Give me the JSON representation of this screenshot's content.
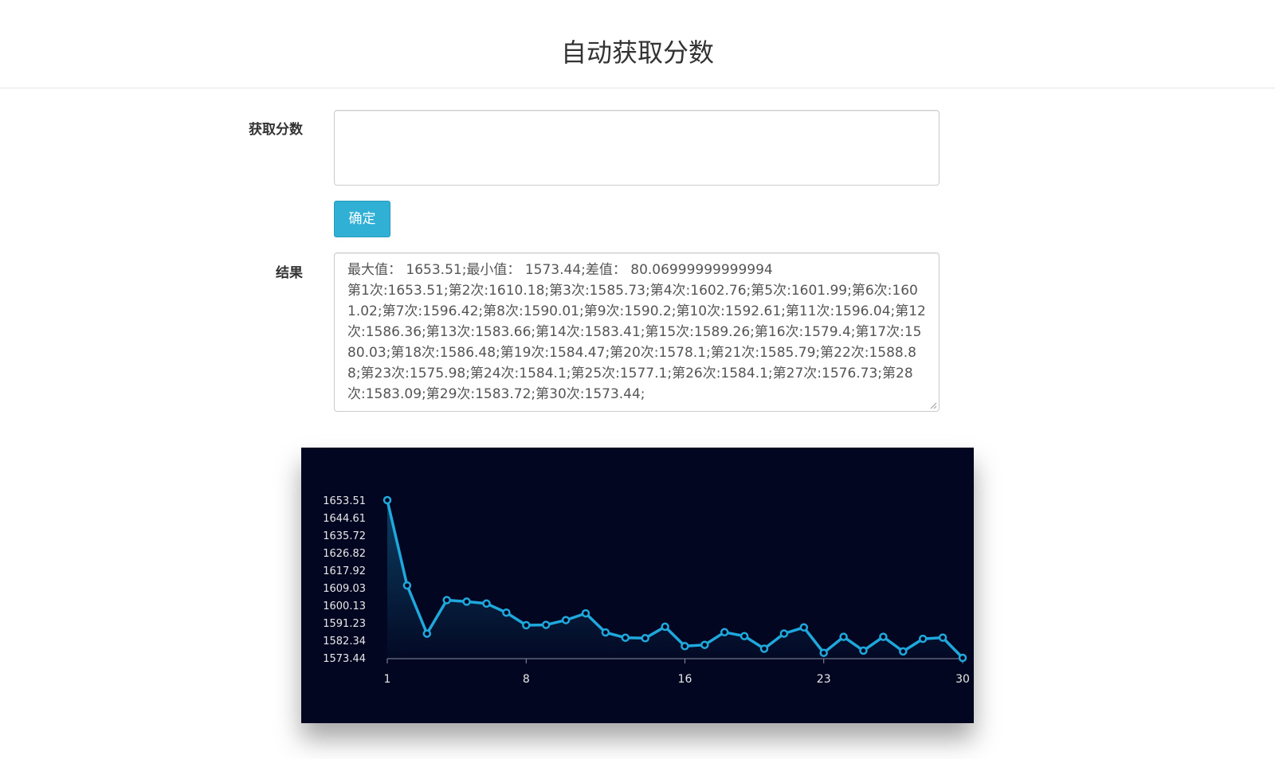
{
  "header": {
    "title": "自动获取分数"
  },
  "form": {
    "score_label": "获取分数",
    "score_value": "",
    "score_placeholder": "",
    "confirm_label": "确定",
    "result_label": "结果",
    "result_line1": "最大值：  1653.51;最小值：  1573.44;差值：  80.06999999999994",
    "result_line2": "第1次:1653.51;第2次:1610.18;第3次:1585.73;第4次:1602.76;第5次:1601.99;第6次:1601.02;第7次:1596.42;第8次:1590.01;第9次:1590.2;第10次:1592.61;第11次:1596.04;第12次:1586.36;第13次:1583.66;第14次:1583.41;第15次:1589.26;第16次:1579.4;第17次:1580.03;第18次:1586.48;第19次:1584.47;第20次:1578.1;第21次:1585.79;第22次:1588.88;第23次:1575.98;第24次:1584.1;第25次:1577.1;第26次:1584.1;第27次:1576.73;第28次:1583.09;第29次:1583.72;第30次:1573.44;"
  },
  "colors": {
    "chart_background": "#020621",
    "line": "#1fa8dc",
    "axis_text": "#e8e8e8",
    "button": "#31b0d5"
  },
  "chart_data": {
    "type": "area",
    "title": "",
    "xlabel": "",
    "ylabel": "",
    "x": [
      1,
      2,
      3,
      4,
      5,
      6,
      7,
      8,
      9,
      10,
      11,
      12,
      13,
      14,
      15,
      16,
      17,
      18,
      19,
      20,
      21,
      22,
      23,
      24,
      25,
      26,
      27,
      28,
      29,
      30
    ],
    "values": [
      1653.51,
      1610.18,
      1585.73,
      1602.76,
      1601.99,
      1601.02,
      1596.42,
      1590.01,
      1590.2,
      1592.61,
      1596.04,
      1586.36,
      1583.66,
      1583.41,
      1589.26,
      1579.4,
      1580.03,
      1586.48,
      1584.47,
      1578.1,
      1585.79,
      1588.88,
      1575.98,
      1584.1,
      1577.1,
      1584.1,
      1576.73,
      1583.09,
      1583.72,
      1573.44
    ],
    "x_ticks": [
      "1",
      "8",
      "16",
      "23",
      "30"
    ],
    "y_ticks": [
      "1573.44",
      "1582.34",
      "1591.23",
      "1600.13",
      "1609.03",
      "1617.92",
      "1626.82",
      "1635.72",
      "1644.61",
      "1653.51"
    ],
    "ylim": [
      1573.44,
      1653.51
    ],
    "xlim": [
      1,
      30
    ],
    "grid": false,
    "legend": "none"
  }
}
